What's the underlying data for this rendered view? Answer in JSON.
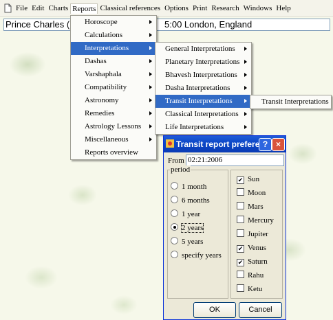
{
  "menubar": {
    "doc_icon": "document-icon",
    "items": [
      "File",
      "Edit",
      "Charts",
      "Reports",
      "Classical references",
      "Options",
      "Print",
      "Research",
      "Windows",
      "Help"
    ]
  },
  "chart_title": {
    "left": "Prince Charles (N",
    "right": "5:00  London, England"
  },
  "reports_menu": {
    "items": [
      "Horoscope",
      "Calculations",
      "Interpretations",
      "Dashas",
      "Varshaphala",
      "Compatibility",
      "Astronomy",
      "Remedies",
      "Astrology Lessons",
      "Miscellaneous",
      "Reports overview"
    ],
    "selected": "Interpretations"
  },
  "interpretations_menu": {
    "items": [
      "General Interpretations",
      "Planetary Interpretations",
      "Bhavesh Interpretations",
      "Dasha Interpretations",
      "Transit Interpretations",
      "Classical Interpretations",
      "Life Interpretations"
    ],
    "selected": "Transit Interpretations"
  },
  "transit_submenu": {
    "items": [
      "Transit Interpretations"
    ]
  },
  "dialog": {
    "title": "Transit report prefere...",
    "title_icon": "app-icon",
    "help_label": "?",
    "close_label": "×",
    "from_label": "From",
    "from_value": "02:21:2006",
    "period_label": "period",
    "periods": [
      "1 month",
      "6 months",
      "1 year",
      "2 years",
      "5 years",
      "specify years"
    ],
    "selected_period": "2 years",
    "planets": [
      {
        "label": "Sun",
        "checked": true
      },
      {
        "label": "Moon",
        "checked": false
      },
      {
        "label": "Mars",
        "checked": false
      },
      {
        "label": "Mercury",
        "checked": false
      },
      {
        "label": "Jupiter",
        "checked": false
      },
      {
        "label": "Venus",
        "checked": true
      },
      {
        "label": "Saturn",
        "checked": true
      },
      {
        "label": "Rahu",
        "checked": false
      },
      {
        "label": "Ketu",
        "checked": false
      }
    ],
    "ok_label": "OK",
    "cancel_label": "Cancel"
  },
  "colors": {
    "highlight": "#316ac5",
    "titlebar": "#0a46c7",
    "dialog_bg": "#ece9d8"
  }
}
